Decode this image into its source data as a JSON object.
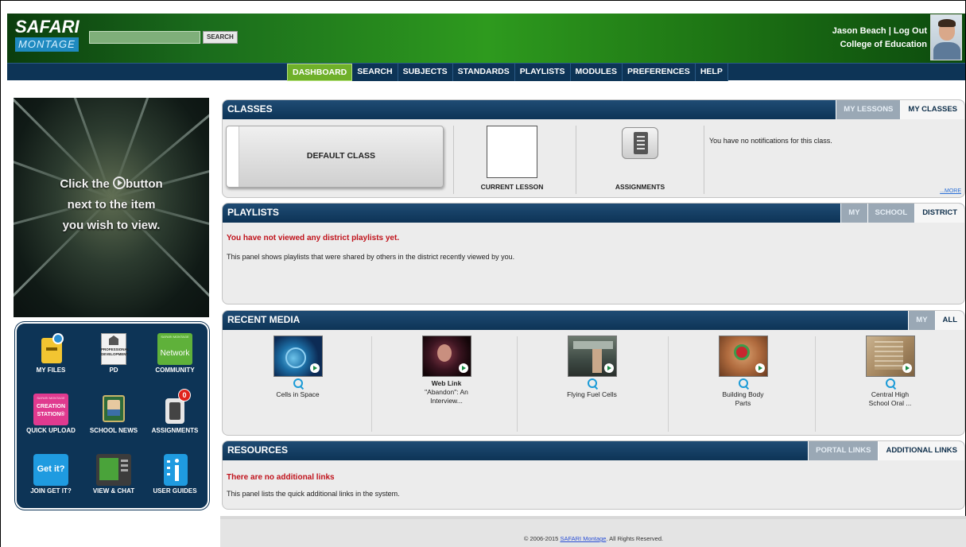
{
  "brand": {
    "line1": "SAFARI",
    "line2": "MONTAGE"
  },
  "header": {
    "search_placeholder": "",
    "search_button": "SEARCH",
    "user_name": "Jason Beach",
    "logout": "Log Out",
    "separator": "|",
    "org": "College of Education"
  },
  "nav": [
    "DASHBOARD",
    "SEARCH",
    "SUBJECTS",
    "STANDARDS",
    "PLAYLISTS",
    "MODULES",
    "PREFERENCES",
    "HELP"
  ],
  "hero": {
    "line1_a": "Click the",
    "line1_b": "button",
    "line2": "next to the item",
    "line3": "you wish to view."
  },
  "tools": {
    "my_files": "MY FILES",
    "pd": "PD",
    "pd_icon_text_1": "PROFESSIONAL",
    "pd_icon_text_2": "DEVELOPMENT",
    "community": "COMMUNITY",
    "community_icon_text_1": "SAFARI MONTAGE",
    "community_icon_text_2": "Network",
    "quick_upload": "QUICK UPLOAD",
    "creation_text_1": "SAFARI MONTAGE",
    "creation_text_2": "CREATION",
    "creation_text_3": "STATION®",
    "school_news": "SCHOOL NEWS",
    "assignments": "ASSIGNMENTS",
    "assignments_badge": "0",
    "join_get_it": "JOIN GET IT?",
    "get_it_icon_text": "Get it?",
    "view_chat": "VIEW & CHAT",
    "user_guides": "USER GUIDES"
  },
  "classes": {
    "title": "CLASSES",
    "tabs": [
      "MY LESSONS",
      "MY CLASSES"
    ],
    "default_class": "DEFAULT CLASS",
    "current_lesson": "CURRENT LESSON",
    "assignments": "ASSIGNMENTS",
    "notification": "You have no notifications for this class.",
    "more": "...MORE"
  },
  "playlists": {
    "title": "PLAYLISTS",
    "tabs": [
      "MY",
      "SCHOOL",
      "DISTRICT"
    ],
    "empty_msg": "You have not viewed any district playlists yet.",
    "desc": "This panel shows playlists that were shared by others in the district recently viewed by you."
  },
  "recent_media": {
    "title": "RECENT MEDIA",
    "tabs": [
      "MY",
      "ALL"
    ],
    "items": [
      {
        "bold": "",
        "line1": "Cells in Space",
        "line2": "",
        "line3": ""
      },
      {
        "bold": "Web Link",
        "line1": "\"Abandon\": An",
        "line2": "Interview...",
        "line3": ""
      },
      {
        "bold": "",
        "line1": "Flying Fuel Cells",
        "line2": "",
        "line3": ""
      },
      {
        "bold": "",
        "line1": "Building Body",
        "line2": "Parts",
        "line3": ""
      },
      {
        "bold": "",
        "line1": "Central High",
        "line2": "School Oral ...",
        "line3": ""
      }
    ]
  },
  "resources": {
    "title": "RESOURCES",
    "tabs": [
      "PORTAL LINKS",
      "ADDITIONAL LINKS"
    ],
    "empty_msg": "There are no additional links",
    "desc": "This panel lists the quick additional links in the system."
  },
  "footer": {
    "prefix": "© 2006-2015",
    "link": "SAFARI Montage",
    "suffix": ". All Rights Reserved."
  }
}
